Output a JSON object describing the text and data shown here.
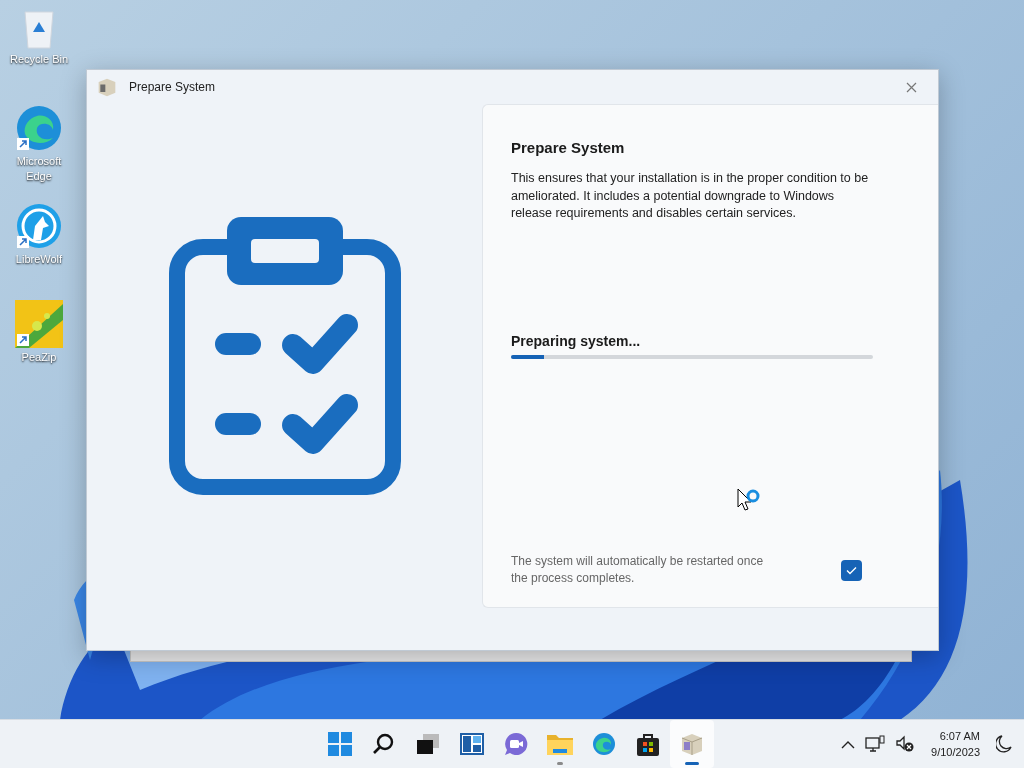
{
  "desktop_icons": [
    {
      "kind": "recycle",
      "label": "Recycle Bin"
    },
    {
      "kind": "edge",
      "label": "Microsoft Edge"
    },
    {
      "kind": "wolf",
      "label": "LibreWolf"
    },
    {
      "kind": "peazip",
      "label": "PeaZip"
    }
  ],
  "dialog": {
    "title": "Prepare System",
    "heading": "Prepare System",
    "description": "This ensures that your installation is in the proper condition to be ameliorated. It includes a potential downgrade to Windows release requirements and disables certain services.",
    "progress": {
      "label": "Preparing system...",
      "level": 0.09
    },
    "restart_note": "The system will automatically be restarted once the process completes.",
    "restart_checkbox": {
      "checked": true
    }
  },
  "taskbar": {
    "apps": [
      {
        "kind": "start",
        "running": false,
        "selected": false
      },
      {
        "kind": "search",
        "running": false,
        "selected": false
      },
      {
        "kind": "taskview",
        "running": false,
        "selected": false
      },
      {
        "kind": "widgets",
        "running": false,
        "selected": false
      },
      {
        "kind": "chat",
        "running": false,
        "selected": false
      },
      {
        "kind": "explorer",
        "running": true,
        "selected": false
      },
      {
        "kind": "edge",
        "running": false,
        "selected": false
      },
      {
        "kind": "store",
        "running": false,
        "selected": false
      },
      {
        "kind": "package",
        "running": true,
        "selected": true
      }
    ],
    "time": "6:07 AM",
    "date": "9/10/2023"
  }
}
